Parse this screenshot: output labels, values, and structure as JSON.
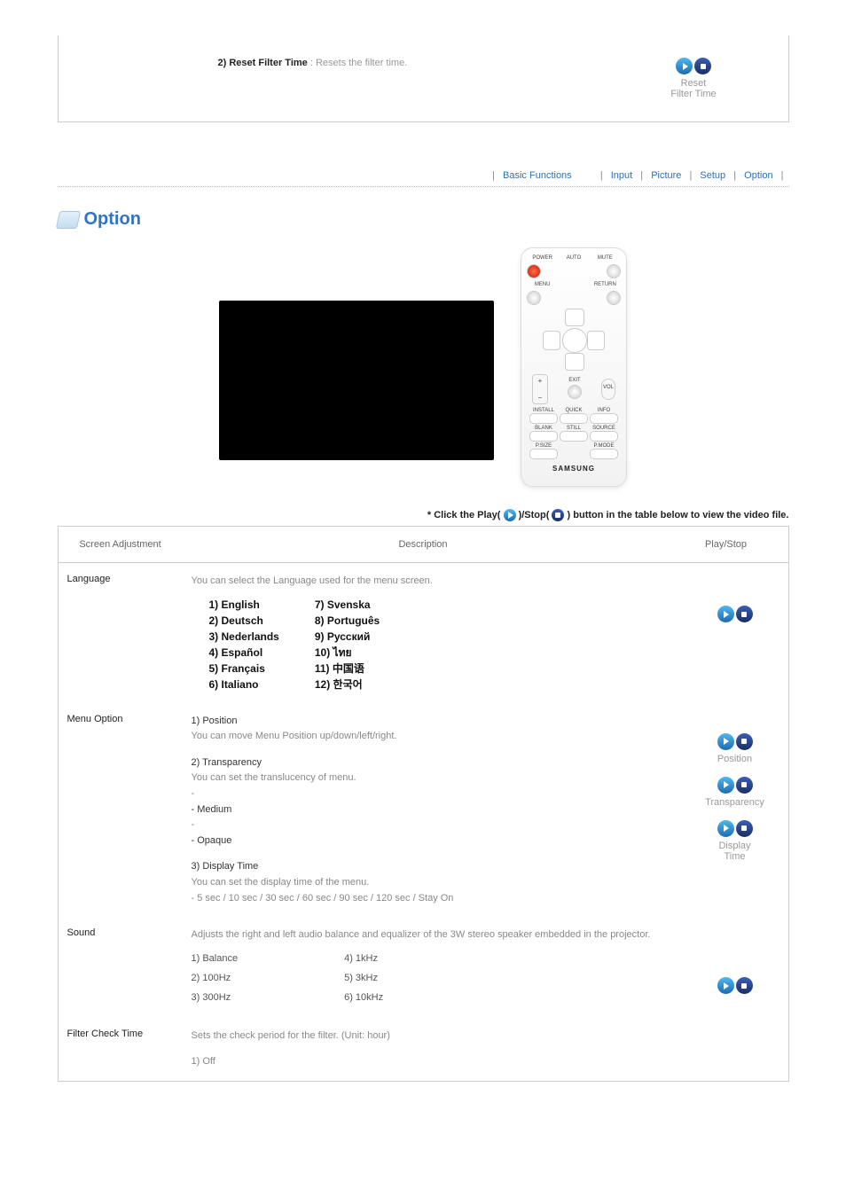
{
  "top": {
    "item_label": "2) Reset Filter Time",
    "item_desc": ": Resets the filter time.",
    "icon_caption1": "Reset",
    "icon_caption2": "Filter Time"
  },
  "crumbs": {
    "basic": "Basic Functions",
    "input": "Input",
    "picture": "Picture",
    "setup": "Setup",
    "option": "Option"
  },
  "option_title": "Option",
  "remote": {
    "power": "POWER",
    "auto": "AUTO",
    "mute": "MUTE",
    "menu": "MENU",
    "return": "RETURN",
    "exit": "EXIT",
    "vol": "VOL",
    "install": "INSTALL",
    "quick": "QUICK",
    "info": "INFO",
    "blank": "BLANK",
    "still": "STILL",
    "source": "SOURCE",
    "psize": "P.SIZE",
    "pmode": "P.MODE",
    "brand": "SAMSUNG"
  },
  "instruction": {
    "t1": "* Click the Play(",
    "t2": ")/Stop(",
    "t3": ") button in the table below to view the video file."
  },
  "headers": {
    "sa": "Screen Adjustment",
    "desc": "Description",
    "ps": "Play/Stop"
  },
  "rows": {
    "language": {
      "label": "Language",
      "intro": "You can select the Language used for the menu screen.",
      "col1": [
        "1) English",
        "2) Deutsch",
        "3) Nederlands",
        "4) Español",
        "5) Français",
        "6) Italiano"
      ],
      "col2": [
        "7) Svenska",
        "8) Português",
        "9) Русский",
        "10) ไทย",
        "11) 中国语",
        "12) 한국어"
      ]
    },
    "menuoption": {
      "label": "Menu Option",
      "pos_head": "1) Position",
      "pos_desc": "You can move Menu Position up/down/left/right.",
      "trans_head": "2) Transparency",
      "trans_desc": "You can set the translucency of menu.",
      "trans_items": [
        "-",
        "- Medium",
        "-",
        "- Opaque"
      ],
      "disp_head": "3) Display Time",
      "disp_desc": "You can set the display time of the menu.",
      "disp_opts": "- 5 sec / 10 sec / 30 sec / 60 sec / 90 sec / 120 sec / Stay On",
      "cap_position": "Position",
      "cap_transparency": "Transparency",
      "cap_display": "Display",
      "cap_time": "Time"
    },
    "sound": {
      "label": "Sound",
      "intro": "Adjusts the right and left audio balance and equalizer of the 3W stereo speaker embedded in the projector.",
      "colA": [
        "1) Balance",
        "2) 100Hz",
        "3) 300Hz"
      ],
      "colB": [
        "4) 1kHz",
        "5) 3kHz",
        "6) 10kHz"
      ]
    },
    "filter": {
      "label": "Filter Check Time",
      "intro": "Sets the check period for the filter. (Unit: hour)",
      "items": [
        "1) Off"
      ]
    }
  }
}
